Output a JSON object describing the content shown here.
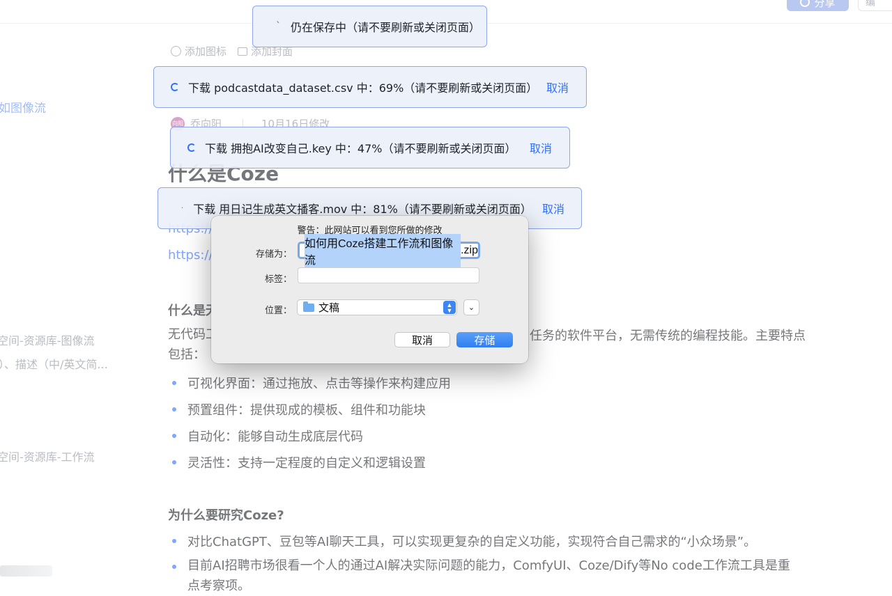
{
  "header": {
    "share_label": "分享",
    "edit_label": "编"
  },
  "sidebar": {
    "fragments": [
      "如图像流",
      "空间-资源库-图像流",
      "）、描述（中/英文简...",
      "空间-资源库-工作流"
    ]
  },
  "doc": {
    "tools": {
      "add_icon": "添加图标",
      "add_cover": "添加封面"
    },
    "author": {
      "avatar_text": "向阳",
      "name": "乔向阳",
      "modified": "10月16日修改"
    },
    "title": "什么是Coze",
    "links": [
      "https://w",
      "https://w"
    ],
    "section1_heading": "什么是无",
    "section1_para": "无代码工",
    "section1_para_right": "任务的软件平台，无需传统的编程技能。主要特点",
    "section1_para_line2": "包括：",
    "bullets1": [
      "可视化界面：通过拖放、点击等操作来构建应用",
      "预置组件：提供现成的模板、组件和功能块",
      "自动化：能够自动生成底层代码",
      "灵活性：支持一定程度的自定义和逻辑设置"
    ],
    "section2_heading": "为什么要研究Coze?",
    "bullets2": [
      "对比ChatGPT、豆包等AI聊天工具，可以实现更复杂的自定义功能，实现符合自己需求的“小众场景”。",
      "目前AI招聘市场很看一个人的通过AI解决实际问题的能力，ComfyUI、Coze/Dify等No code工作流工具是重点考察项。"
    ]
  },
  "toasts": {
    "saving": "仍在保存中（请不要刷新或关闭页面）",
    "downloads": [
      {
        "text": "下载 podcastdata_dataset.csv 中：69%（请不要刷新或关闭页面）",
        "cancel": "取消"
      },
      {
        "text": "下载 拥抱AI改变自己.key 中：47%（请不要刷新或关闭页面）",
        "cancel": "取消"
      },
      {
        "text": "下载 用日记生成英文播客.mov 中：81%（请不要刷新或关闭页面）",
        "cancel": "取消"
      }
    ]
  },
  "dialog": {
    "warning": "警告：此网站可以看到您所做的修改",
    "save_as_label": "存储为：",
    "filename_selected": "如何用Coze搭建工作流和图像流",
    "filename_ext": ".zip",
    "tags_label": "标签：",
    "location_label": "位置：",
    "location_value": "文稿",
    "cancel_label": "取消",
    "save_label": "存储"
  },
  "colors": {
    "accent": "#3370ff",
    "toast_border": "#8ea7e9",
    "mac_blue": "#2f7ef2"
  }
}
